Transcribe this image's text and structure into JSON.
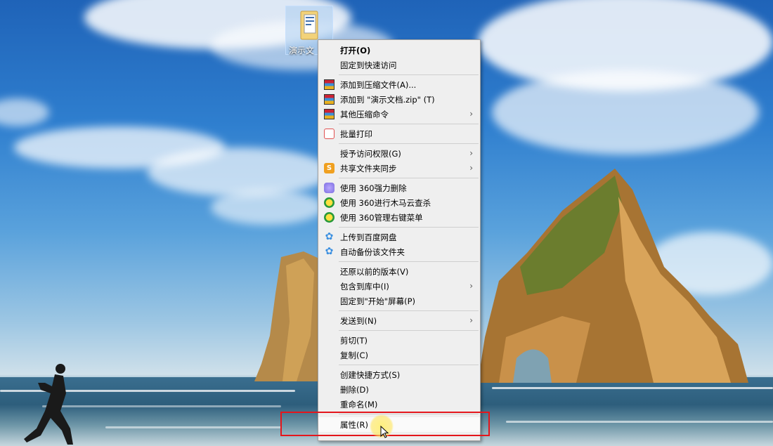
{
  "desktop": {
    "icon_label": "演示文"
  },
  "context_menu": {
    "items": [
      {
        "label": "打开(O)",
        "bold": true,
        "icon": "none"
      },
      {
        "label": "固定到快速访问",
        "icon": "none"
      },
      {
        "label": "添加到压缩文件(A)...",
        "icon": "archive-icon"
      },
      {
        "label": "添加到 \"演示文档.zip\" (T)",
        "icon": "archive-icon"
      },
      {
        "label": "其他压缩命令",
        "icon": "archive-icon",
        "submenu": true
      },
      {
        "label": "批量打印",
        "icon": "printer-icon"
      },
      {
        "label": "授予访问权限(G)",
        "icon": "none",
        "submenu": true
      },
      {
        "label": "共享文件夹同步",
        "icon": "share-sync-icon",
        "submenu": true
      },
      {
        "label": "使用 360强力删除",
        "icon": "shred-icon"
      },
      {
        "label": "使用 360进行木马云查杀",
        "icon": "360-icon"
      },
      {
        "label": "使用 360管理右键菜单",
        "icon": "360-icon"
      },
      {
        "label": "上传到百度网盘",
        "icon": "baidu-netdisk-icon"
      },
      {
        "label": "自动备份该文件夹",
        "icon": "baidu-netdisk-icon"
      },
      {
        "label": "还原以前的版本(V)",
        "icon": "none"
      },
      {
        "label": "包含到库中(I)",
        "icon": "none",
        "submenu": true
      },
      {
        "label": "固定到\"开始\"屏幕(P)",
        "icon": "none"
      },
      {
        "label": "发送到(N)",
        "icon": "none",
        "submenu": true
      },
      {
        "label": "剪切(T)",
        "icon": "none"
      },
      {
        "label": "复制(C)",
        "icon": "none"
      },
      {
        "label": "创建快捷方式(S)",
        "icon": "none"
      },
      {
        "label": "删除(D)",
        "icon": "none"
      },
      {
        "label": "重命名(M)",
        "icon": "none"
      },
      {
        "label": "属性(R)",
        "icon": "none",
        "highlighted": true
      }
    ],
    "submenu_glyph": "›"
  },
  "colors": {
    "highlight_border": "#e4161c",
    "menu_background": "#efefef"
  }
}
